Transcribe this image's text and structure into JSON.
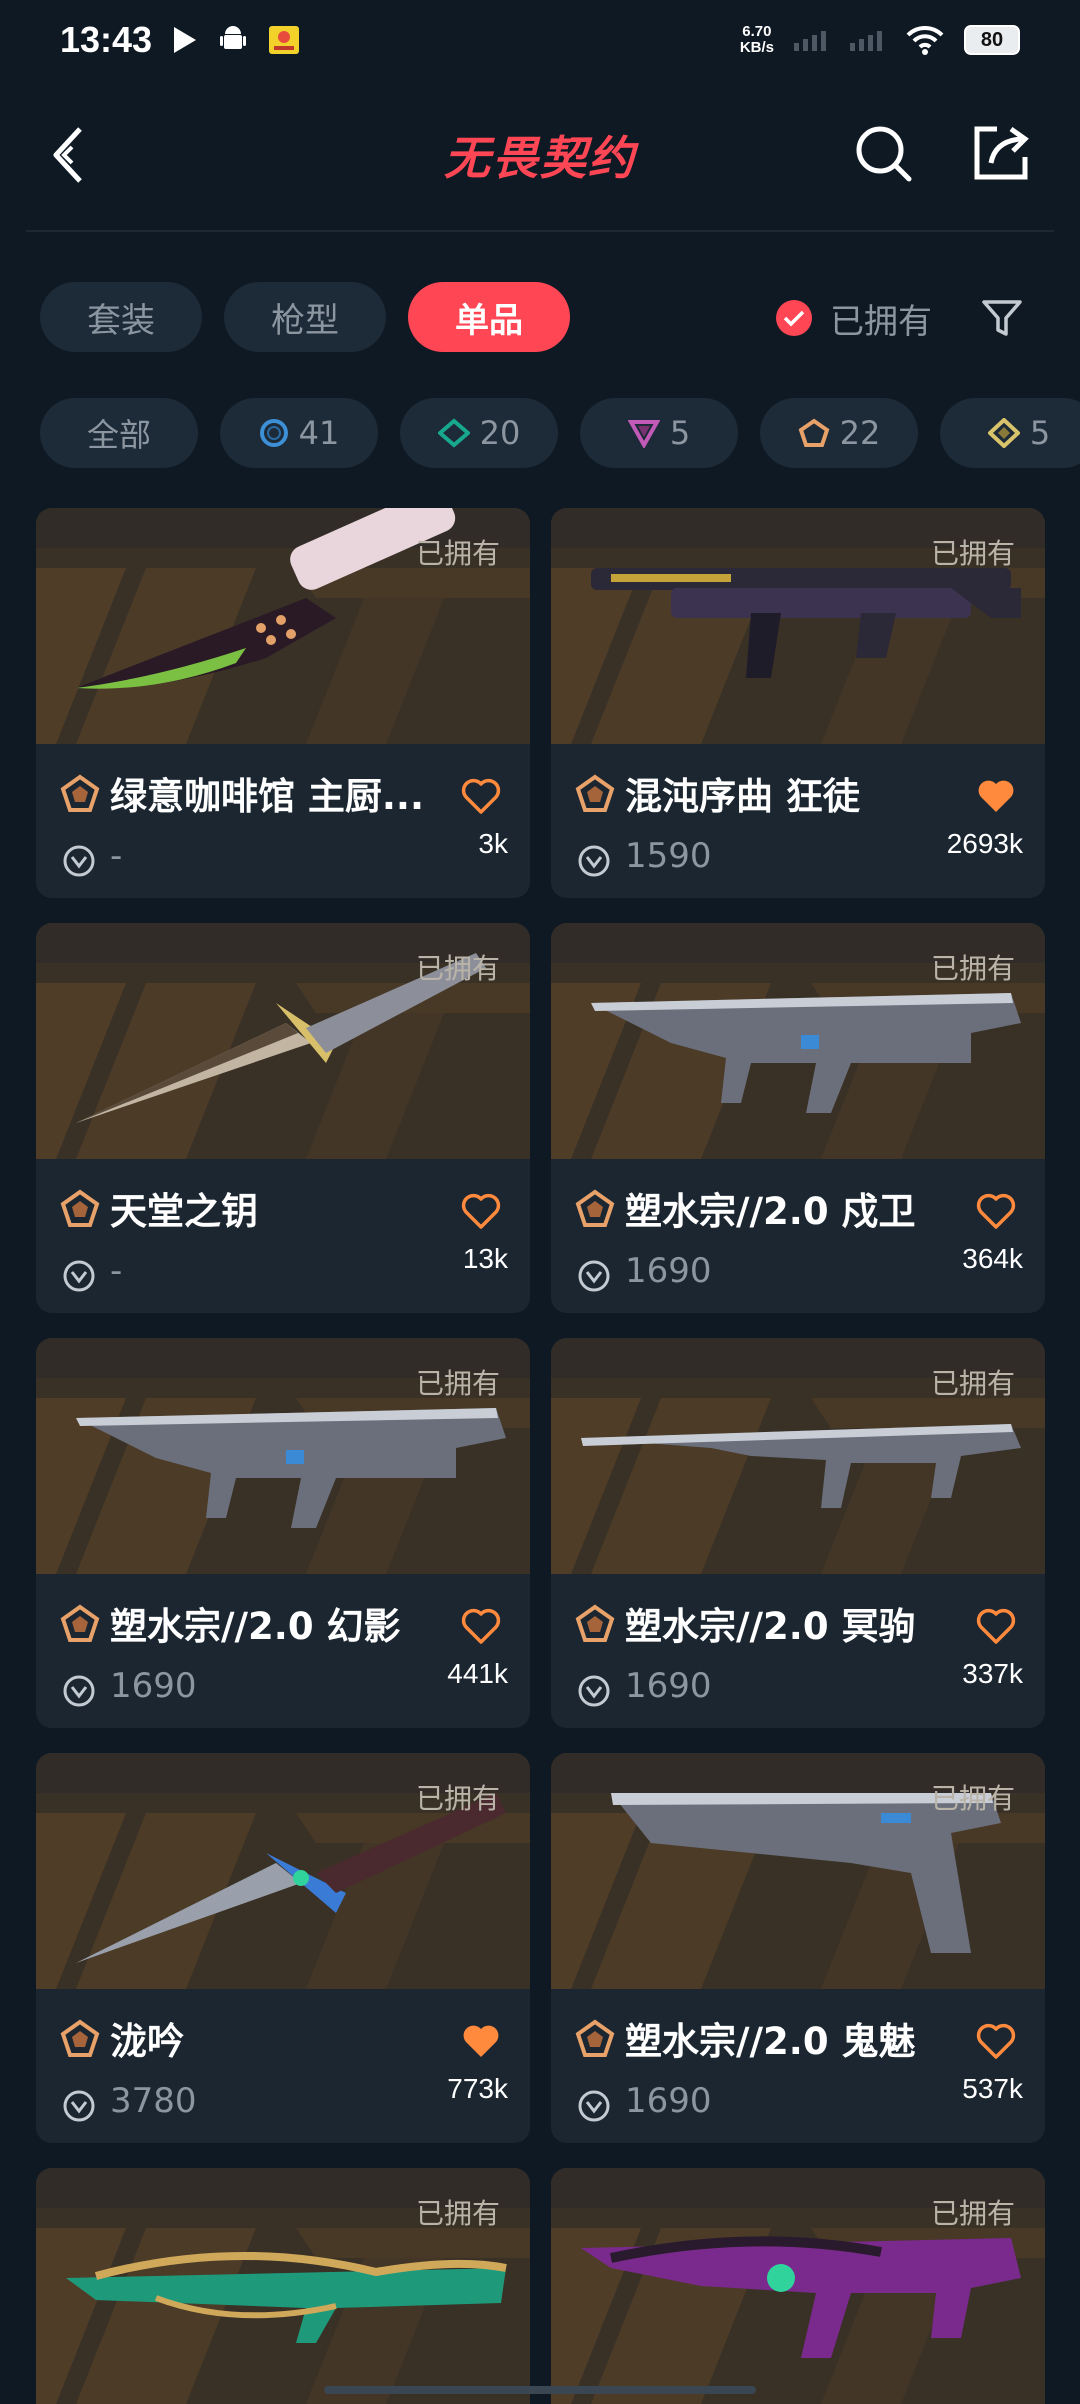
{
  "status_bar": {
    "time": "13:43",
    "net_speed_value": "6.70",
    "net_speed_unit": "KB/s",
    "battery": "80"
  },
  "header": {
    "logo_text": "无畏契约"
  },
  "tabs": [
    {
      "label": "套装",
      "active": false
    },
    {
      "label": "枪型",
      "active": false
    },
    {
      "label": "单品",
      "active": true
    }
  ],
  "owned_filter": {
    "label": "已拥有",
    "checked": true
  },
  "chips": [
    {
      "label": "全部",
      "icon": null
    },
    {
      "label": "41",
      "icon": "select-tier-icon",
      "color": "#3d8fd6"
    },
    {
      "label": "20",
      "icon": "deluxe-tier-icon",
      "color": "#17a88e"
    },
    {
      "label": "5",
      "icon": "exclusive-tier-icon",
      "color": "#c25ab8"
    },
    {
      "label": "22",
      "icon": "premium-tier-icon",
      "color": "#e8a168"
    },
    {
      "label": "5",
      "icon": "ultra-tier-icon",
      "color": "#d9c36b"
    }
  ],
  "items": [
    {
      "name": "绿意咖啡馆 主厨...",
      "price": "-",
      "likes": "3k",
      "liked": false,
      "owned_label": "已拥有",
      "weapon": "knife"
    },
    {
      "name": "混沌序曲 狂徒",
      "price": "1590",
      "likes": "2693k",
      "liked": true,
      "owned_label": "已拥有",
      "weapon": "rifle-dark"
    },
    {
      "name": "天堂之钥",
      "price": "-",
      "likes": "13k",
      "liked": false,
      "owned_label": "已拥有",
      "weapon": "dagger"
    },
    {
      "name": "塑水宗//2.0 戍卫",
      "price": "1690",
      "likes": "364k",
      "liked": false,
      "owned_label": "已拥有",
      "weapon": "rifle-silver"
    },
    {
      "name": "塑水宗//2.0 幻影",
      "price": "1690",
      "likes": "441k",
      "liked": false,
      "owned_label": "已拥有",
      "weapon": "rifle-silver"
    },
    {
      "name": "塑水宗//2.0 冥驹",
      "price": "1690",
      "likes": "337k",
      "liked": false,
      "owned_label": "已拥有",
      "weapon": "sniper-silver"
    },
    {
      "name": "泷吟",
      "price": "3780",
      "likes": "773k",
      "liked": true,
      "owned_label": "已拥有",
      "weapon": "kunai"
    },
    {
      "name": "塑水宗//2.0 鬼魅",
      "price": "1690",
      "likes": "537k",
      "liked": false,
      "owned_label": "已拥有",
      "weapon": "pistol"
    },
    {
      "name": "",
      "price": "",
      "likes": "",
      "liked": false,
      "owned_label": "已拥有",
      "weapon": "sniper-green"
    },
    {
      "name": "",
      "price": "",
      "likes": "",
      "liked": false,
      "owned_label": "已拥有",
      "weapon": "rifle-purple"
    }
  ],
  "colors": {
    "accent": "#ff4655",
    "heart": "#ff8a3d",
    "background": "#0f1923"
  }
}
